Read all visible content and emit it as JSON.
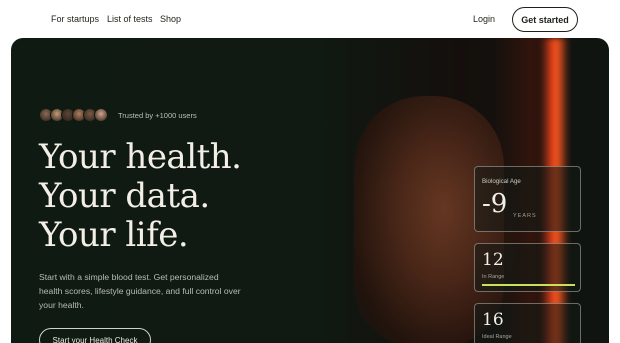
{
  "nav": {
    "links": [
      "For startups",
      "List of tests",
      "Shop"
    ],
    "login": "Login",
    "cta": "Get started"
  },
  "hero": {
    "trusted": "Trusted by +1000 users",
    "headline": [
      "Your health.",
      "Your data.",
      "Your life."
    ],
    "subtext": "Start with a simple blood test. Get personalized health scores, lifestyle guidance, and full control over your health.",
    "cta": "Start your Health Check",
    "avatar_colors": [
      "#8a6b55",
      "#c79a7a",
      "#5a4636",
      "#b08060",
      "#7a5a44",
      "#d0a48a"
    ]
  },
  "cards": {
    "bio_age": {
      "label": "Biological Age",
      "value": "-9",
      "unit": "YEARS"
    },
    "in_range": {
      "value": "12",
      "label": "In Range",
      "progress": 1.0
    },
    "ideal_range": {
      "value": "16",
      "label": "Ideal Range"
    }
  },
  "colors": {
    "accent": "#c8e05a",
    "panel": "#101a12",
    "stripe": "#ff5a20"
  }
}
